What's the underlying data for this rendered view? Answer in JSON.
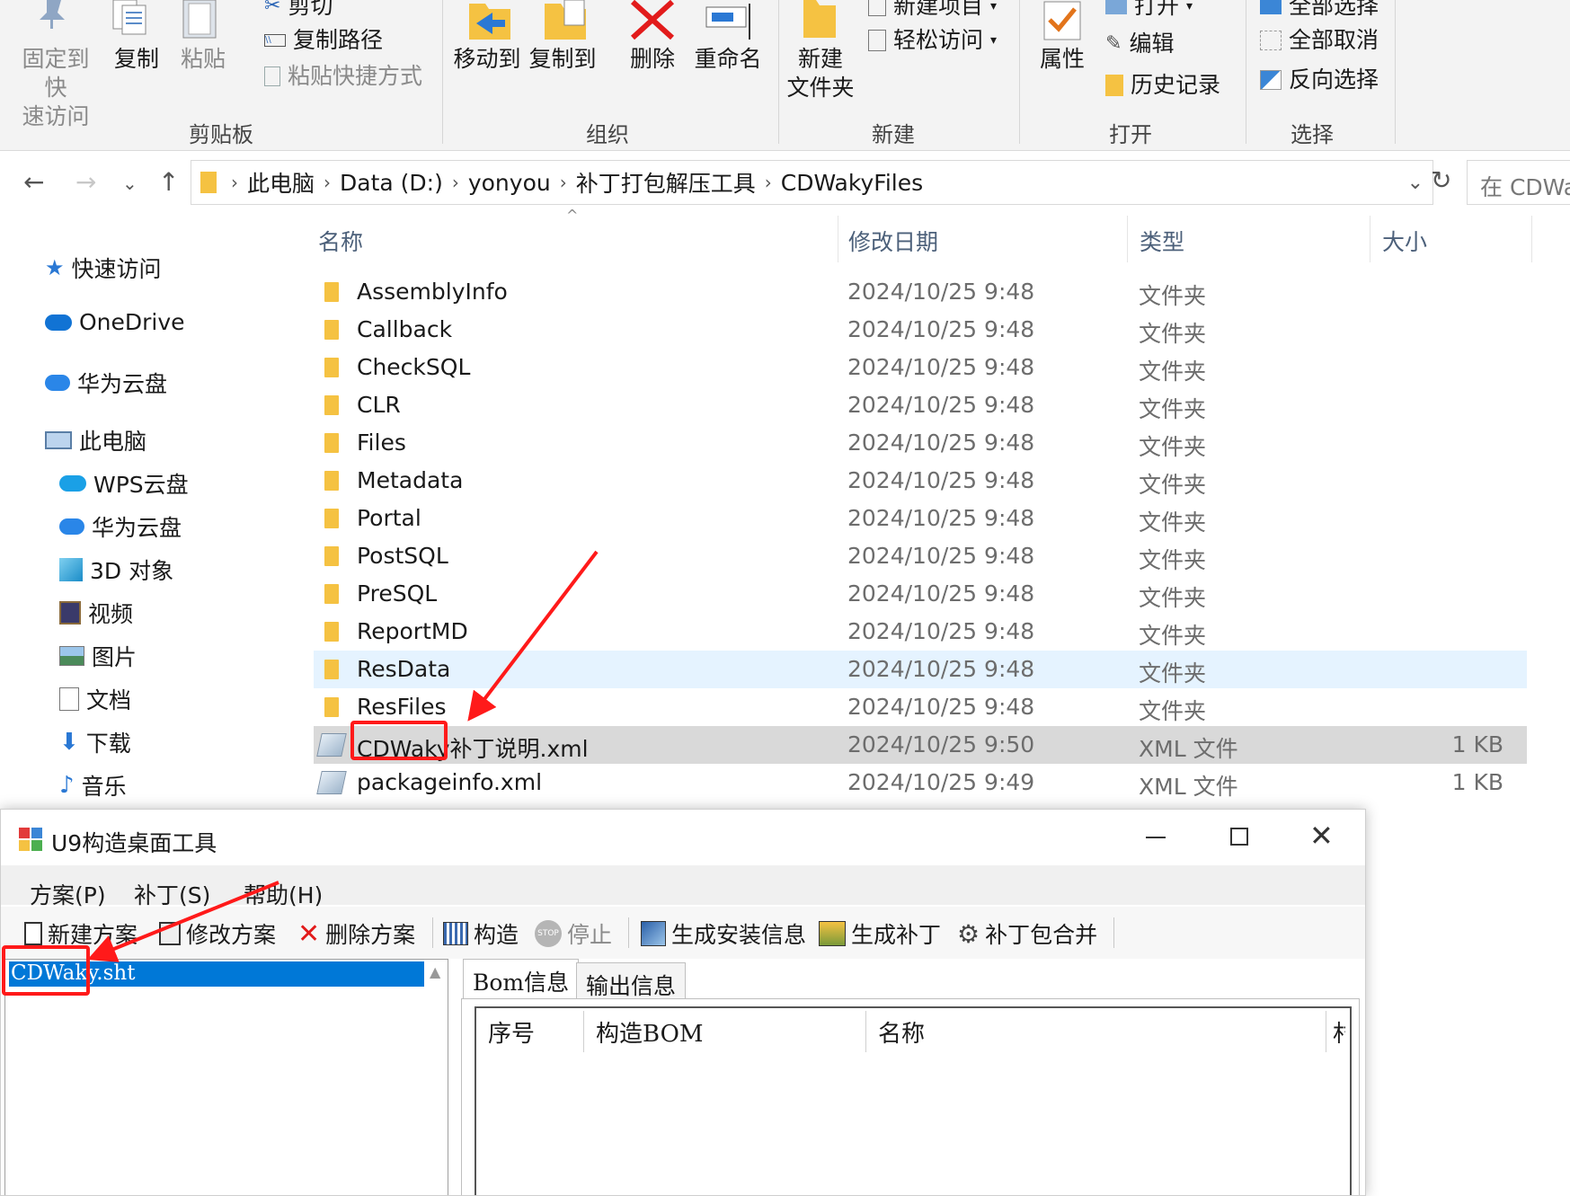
{
  "ribbon": {
    "clipboard": {
      "pin_label": "固定到快\n速访问",
      "copy_label": "复制",
      "paste_label": "粘贴",
      "cut_label": "剪切",
      "copy_path_label": "复制路径",
      "paste_shortcut_label": "粘贴快捷方式",
      "group_label": "剪贴板"
    },
    "organize": {
      "move_to_label": "移动到",
      "copy_to_label": "复制到",
      "delete_label": "删除",
      "rename_label": "重命名",
      "group_label": "组织"
    },
    "new": {
      "new_folder_label": "新建\n文件夹",
      "new_item_label": "新建项目",
      "easy_access_label": "轻松访问",
      "group_label": "新建"
    },
    "open": {
      "properties_label": "属性",
      "open_label": "打开",
      "edit_label": "编辑",
      "history_label": "历史记录",
      "group_label": "打开"
    },
    "select": {
      "select_all_label": "全部选择",
      "select_none_label": "全部取消",
      "invert_label": "反向选择",
      "group_label": "选择"
    }
  },
  "address": {
    "crumbs": [
      "此电脑",
      "Data (D:)",
      "yonyou",
      "补丁打包解压工具",
      "CDWakyFiles"
    ],
    "search_placeholder": "在 CDWa"
  },
  "nav_pane": {
    "items": [
      {
        "label": "快速访问",
        "icon": "star-icon"
      },
      {
        "label": "OneDrive",
        "icon": "cloud-icon"
      },
      {
        "label": "华为云盘",
        "icon": "cloud-icon"
      },
      {
        "label": "此电脑",
        "icon": "computer-icon"
      },
      {
        "label": "WPS云盘",
        "icon": "cloud-icon"
      },
      {
        "label": "华为云盘",
        "icon": "cloud-icon"
      },
      {
        "label": "3D 对象",
        "icon": "cube-icon"
      },
      {
        "label": "视频",
        "icon": "video-icon"
      },
      {
        "label": "图片",
        "icon": "picture-icon"
      },
      {
        "label": "文档",
        "icon": "document-icon"
      },
      {
        "label": "下载",
        "icon": "download-icon"
      },
      {
        "label": "音乐",
        "icon": "music-icon"
      }
    ]
  },
  "file_list": {
    "columns": {
      "name": "名称",
      "date": "修改日期",
      "type": "类型",
      "size": "大小"
    },
    "rows": [
      {
        "name": "AssemblyInfo",
        "date": "2024/10/25 9:48",
        "type": "文件夹",
        "size": "",
        "kind": "folder"
      },
      {
        "name": "Callback",
        "date": "2024/10/25 9:48",
        "type": "文件夹",
        "size": "",
        "kind": "folder"
      },
      {
        "name": "CheckSQL",
        "date": "2024/10/25 9:48",
        "type": "文件夹",
        "size": "",
        "kind": "folder"
      },
      {
        "name": "CLR",
        "date": "2024/10/25 9:48",
        "type": "文件夹",
        "size": "",
        "kind": "folder"
      },
      {
        "name": "Files",
        "date": "2024/10/25 9:48",
        "type": "文件夹",
        "size": "",
        "kind": "folder"
      },
      {
        "name": "Metadata",
        "date": "2024/10/25 9:48",
        "type": "文件夹",
        "size": "",
        "kind": "folder"
      },
      {
        "name": "Portal",
        "date": "2024/10/25 9:48",
        "type": "文件夹",
        "size": "",
        "kind": "folder"
      },
      {
        "name": "PostSQL",
        "date": "2024/10/25 9:48",
        "type": "文件夹",
        "size": "",
        "kind": "folder"
      },
      {
        "name": "PreSQL",
        "date": "2024/10/25 9:48",
        "type": "文件夹",
        "size": "",
        "kind": "folder"
      },
      {
        "name": "ReportMD",
        "date": "2024/10/25 9:48",
        "type": "文件夹",
        "size": "",
        "kind": "folder"
      },
      {
        "name": "ResData",
        "date": "2024/10/25 9:48",
        "type": "文件夹",
        "size": "",
        "kind": "folder"
      },
      {
        "name": "ResFiles",
        "date": "2024/10/25 9:48",
        "type": "文件夹",
        "size": "",
        "kind": "folder"
      },
      {
        "name": "CDWaky补丁说明.xml",
        "date": "2024/10/25 9:50",
        "type": "XML 文件",
        "size": "1 KB",
        "kind": "xml"
      },
      {
        "name": "packageinfo.xml",
        "date": "2024/10/25 9:49",
        "type": "XML 文件",
        "size": "1 KB",
        "kind": "xml"
      }
    ]
  },
  "dialog": {
    "title": "U9构造桌面工具",
    "menu": [
      "方案(P)",
      "补丁(S)",
      "帮助(H)"
    ],
    "toolbar": [
      "新建方案",
      "修改方案",
      "删除方案",
      "构造",
      "停止",
      "生成安装信息",
      "生成补丁",
      "补丁包合并"
    ],
    "list_item": "CDWaky.sht",
    "tabs": [
      "Bom信息",
      "输出信息"
    ],
    "grid_headers": [
      "序号",
      "构造BOM",
      "名称",
      "村"
    ]
  },
  "colors": {
    "ribbon_bg": "#f3f3f3",
    "hover_row": "#e5f3ff",
    "selected_row": "#d9d9d9",
    "folder": "#f5c242",
    "annotation_red": "#ff1a1a",
    "list_selection": "#0078d7"
  }
}
